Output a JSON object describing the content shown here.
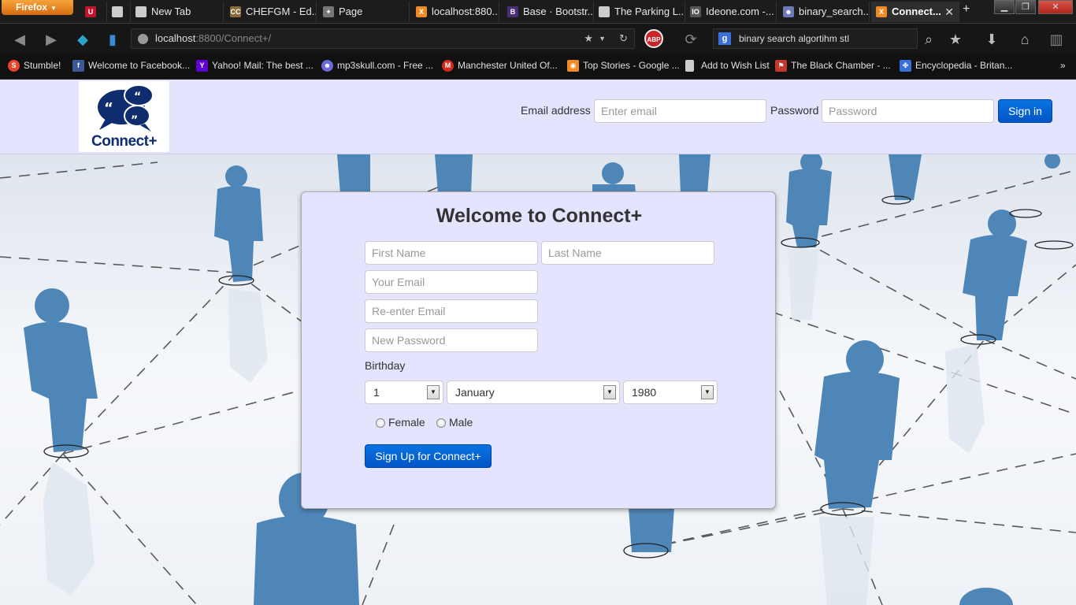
{
  "browser": {
    "menu_button": "Firefox",
    "tabs": [
      {
        "label": "",
        "icon": "uva-icon",
        "active": false
      },
      {
        "label": "",
        "icon": "page-icon",
        "active": false
      },
      {
        "label": "New Tab",
        "icon": "page-icon",
        "active": false
      },
      {
        "label": "CHEFGM - Ed...",
        "icon": "codechef-icon",
        "active": false
      },
      {
        "label": "Page",
        "icon": "puzzle-icon",
        "active": false
      },
      {
        "label": "localhost:880...",
        "icon": "xampp-icon",
        "active": false
      },
      {
        "label": "Base · Bootstr...",
        "icon": "bootstrap-icon",
        "active": false
      },
      {
        "label": "The Parking L...",
        "icon": "page-icon",
        "active": false
      },
      {
        "label": "Ideone.com -...",
        "icon": "ideone-icon",
        "active": false
      },
      {
        "label": "binary_search...",
        "icon": "people-icon",
        "active": false
      },
      {
        "label": "Connect...",
        "icon": "xampp-icon",
        "active": true
      }
    ],
    "url_host": "localhost",
    "url_rest": ":8800/Connect+/",
    "search_text": "binary search algortihm stl",
    "bookmarks": [
      {
        "label": "Stumble!",
        "icon": "stumbleupon-icon",
        "color": "#e9442b"
      },
      {
        "label": "Welcome to Facebook...",
        "icon": "facebook-icon",
        "color": "#3b5998"
      },
      {
        "label": "Yahoo! Mail: The best ...",
        "icon": "yahoo-icon",
        "color": "#5f01d1"
      },
      {
        "label": "mp3skull.com - Free ...",
        "icon": "alien-icon",
        "color": "#6a6ad8"
      },
      {
        "label": "Manchester United Of...",
        "icon": "manutd-icon",
        "color": "#d52a1e"
      },
      {
        "label": "Top Stories - Google ...",
        "icon": "rss-icon",
        "color": "#f08a24"
      },
      {
        "label": "Add to Wish List",
        "icon": "page-icon",
        "color": "#cccccc"
      },
      {
        "label": "The Black Chamber - ...",
        "icon": "bookmark-icon",
        "color": "#c0392b"
      },
      {
        "label": "Encyclopedia - Britan...",
        "icon": "britannica-icon",
        "color": "#3b6fd8"
      }
    ]
  },
  "header": {
    "logo_text": "Connect+",
    "email_label": "Email address",
    "email_placeholder": "Enter email",
    "password_label": "Password",
    "password_placeholder": "Password",
    "signin_label": "Sign in"
  },
  "signup": {
    "title": "Welcome to Connect+",
    "first_name_placeholder": "First Name",
    "last_name_placeholder": "Last Name",
    "email_placeholder": "Your Email",
    "reenter_email_placeholder": "Re-enter Email",
    "password_placeholder": "New Password",
    "birthday_label": "Birthday",
    "day_value": "1",
    "month_value": "January",
    "year_value": "1980",
    "female_label": "Female",
    "male_label": "Male",
    "button_label": "Sign Up for Connect+"
  },
  "colors": {
    "header_bg": "#e4e4fe",
    "panel_bg": "#e4e4fe",
    "button_blue": "#0055c6",
    "figure_blue": "#4f86b8",
    "firefox_orange": "#e8841c"
  }
}
